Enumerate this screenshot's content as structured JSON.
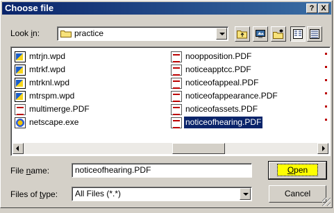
{
  "dialog": {
    "title": "Choose file",
    "help_label": "?",
    "close_label": "X"
  },
  "lookin": {
    "label_pre": "Look ",
    "label_accel": "i",
    "label_post": "n:",
    "value": "practice"
  },
  "toolbar": {
    "icons": [
      "up-folder-icon",
      "desktop-icon",
      "new-folder-icon",
      "list-view-icon",
      "details-view-icon"
    ]
  },
  "files": {
    "column1": [
      {
        "name": "mtrjn.wpd",
        "type": "wpd"
      },
      {
        "name": "mtrkf.wpd",
        "type": "wpd"
      },
      {
        "name": "mtrknl.wpd",
        "type": "wpd"
      },
      {
        "name": "mtrspm.wpd",
        "type": "wpd"
      },
      {
        "name": "multimerge.PDF",
        "type": "pdf"
      },
      {
        "name": "netscape.exe",
        "type": "exe"
      }
    ],
    "column2": [
      {
        "name": "noopposition.PDF",
        "type": "pdf"
      },
      {
        "name": "noticeapptcc.PDF",
        "type": "pdf"
      },
      {
        "name": "noticeofappeal.PDF",
        "type": "pdf"
      },
      {
        "name": "noticeofappearance.PDF",
        "type": "pdf"
      },
      {
        "name": "noticeofassets.PDF",
        "type": "pdf"
      },
      {
        "name": "noticeofhearing.PDF",
        "type": "pdf",
        "selected": true
      }
    ]
  },
  "filename": {
    "label_pre": "File ",
    "label_accel": "n",
    "label_post": "ame:",
    "value": "noticeofhearing.PDF"
  },
  "filetype": {
    "label_pre": "Files of ",
    "label_accel": "t",
    "label_post": "ype:",
    "value": "All Files (*.*)"
  },
  "buttons": {
    "open_accel": "O",
    "open_rest": "pen",
    "cancel": "Cancel"
  },
  "colors": {
    "title_start": "#0a246a",
    "title_end": "#3a6ea5",
    "selection": "#0a246a",
    "face": "#d4d0c8",
    "open_focus": "#ffff00"
  }
}
